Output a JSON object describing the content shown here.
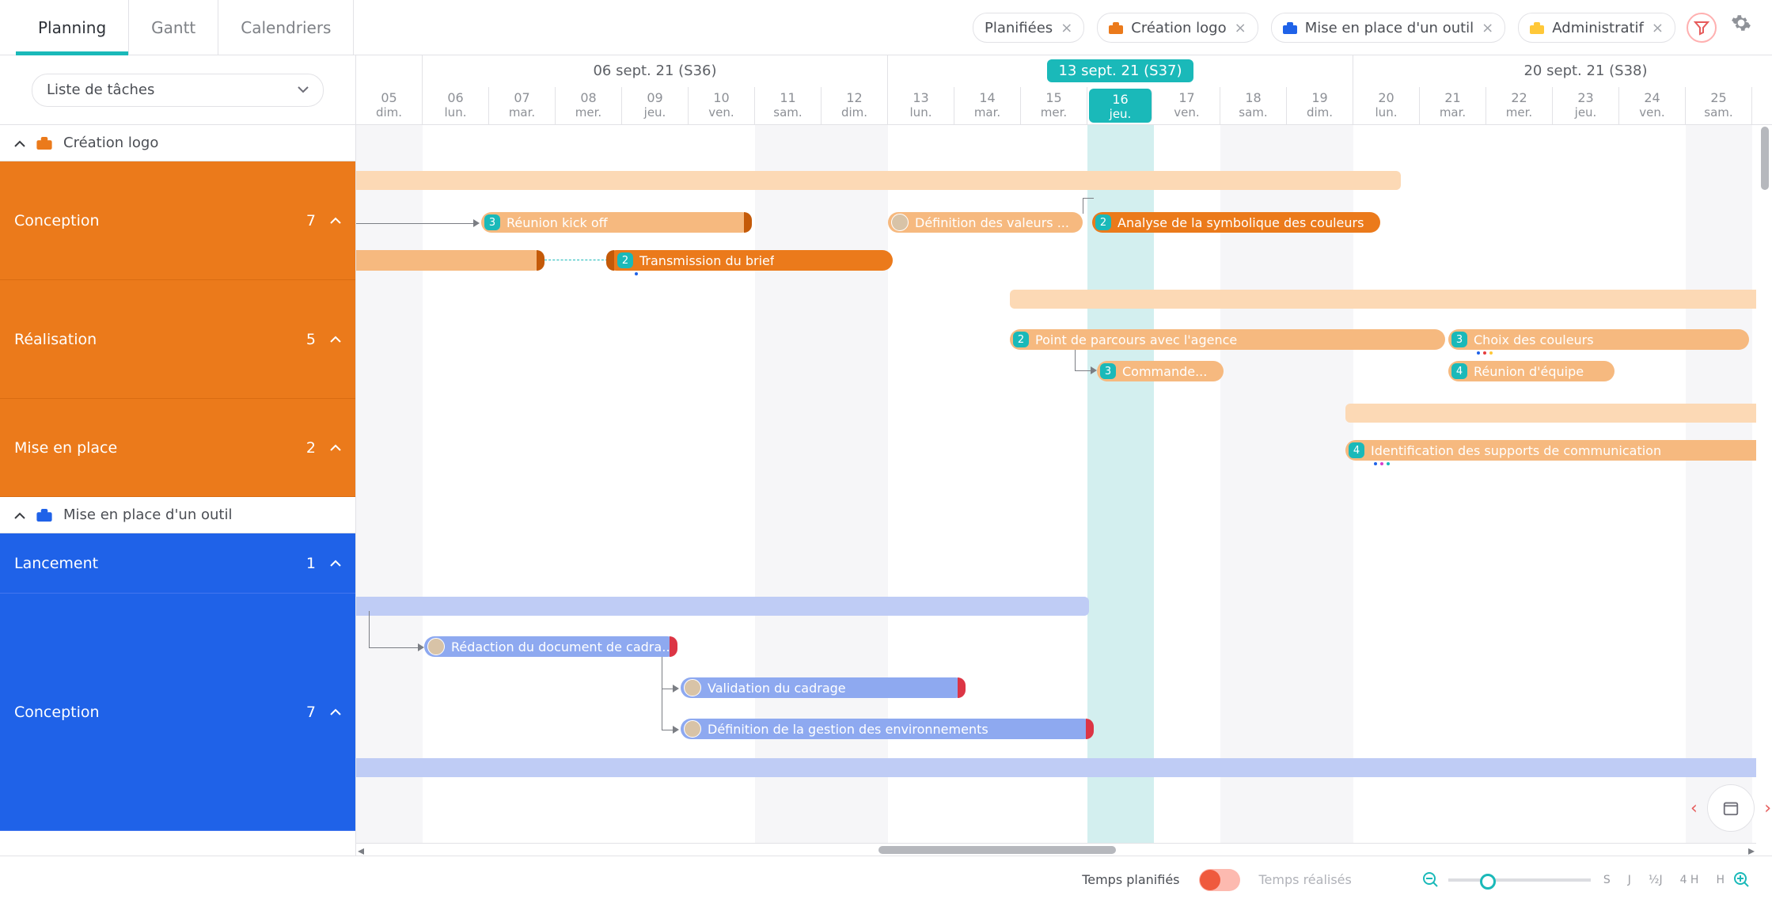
{
  "tabs": {
    "planning": "Planning",
    "gantt": "Gantt",
    "calendriers": "Calendriers"
  },
  "filters": {
    "planifiees": "Planifiées",
    "creation_logo": "Création logo",
    "mise_outil": "Mise en place d'un outil",
    "administratif": "Administratif"
  },
  "sidebar": {
    "select_label": "Liste de tâches",
    "projects": [
      {
        "name": "Création logo",
        "color": "orange",
        "sections": [
          {
            "label": "Conception",
            "count": 7
          },
          {
            "label": "Réalisation",
            "count": 5
          },
          {
            "label": "Mise en place",
            "count": 2
          }
        ]
      },
      {
        "name": "Mise en place d'un outil",
        "color": "blue",
        "sections": [
          {
            "label": "Lancement",
            "count": 1
          },
          {
            "label": "Conception",
            "count": 7
          }
        ]
      }
    ]
  },
  "timeline": {
    "weeks": [
      {
        "label": "06 sept. 21 (S36)",
        "days": 7,
        "current": false
      },
      {
        "label": "13 sept. 21 (S37)",
        "days": 7,
        "current": true
      },
      {
        "label": "20 sept. 21 (S38)",
        "days": 7,
        "current": false
      }
    ],
    "days": [
      {
        "n": "05",
        "d": "dim.",
        "we": true
      },
      {
        "n": "06",
        "d": "lun."
      },
      {
        "n": "07",
        "d": "mar."
      },
      {
        "n": "08",
        "d": "mer."
      },
      {
        "n": "09",
        "d": "jeu."
      },
      {
        "n": "10",
        "d": "ven."
      },
      {
        "n": "11",
        "d": "sam.",
        "we": true
      },
      {
        "n": "12",
        "d": "dim.",
        "we": true
      },
      {
        "n": "13",
        "d": "lun."
      },
      {
        "n": "14",
        "d": "mar."
      },
      {
        "n": "15",
        "d": "mer."
      },
      {
        "n": "16",
        "d": "jeu.",
        "today": true
      },
      {
        "n": "17",
        "d": "ven."
      },
      {
        "n": "18",
        "d": "sam.",
        "we": true
      },
      {
        "n": "19",
        "d": "dim.",
        "we": true
      },
      {
        "n": "20",
        "d": "lun."
      },
      {
        "n": "21",
        "d": "mar."
      },
      {
        "n": "22",
        "d": "mer."
      },
      {
        "n": "23",
        "d": "jeu."
      },
      {
        "n": "24",
        "d": "ven."
      },
      {
        "n": "25",
        "d": "sam.",
        "we": true
      }
    ],
    "tasks": {
      "reunion_kickoff": {
        "label": "Réunion kick off",
        "badge": 3
      },
      "definition_valeurs": {
        "label": "Définition des valeurs ..."
      },
      "analyse_couleurs": {
        "label": "Analyse de la symbolique des couleurs",
        "badge": 2
      },
      "transmission_brief": {
        "label": "Transmission du brief",
        "badge": 2
      },
      "point_parcours": {
        "label": "Point de parcours avec l'agence",
        "badge": 2
      },
      "choix_couleurs": {
        "label": "Choix des couleurs",
        "badge": 3
      },
      "commande": {
        "label": "Commande...",
        "badge": 3
      },
      "reunion_equipe": {
        "label": "Réunion d'équipe",
        "badge": 4
      },
      "identification_supports": {
        "label": "Identification des supports de communication",
        "badge": 4
      },
      "redaction_cadrage": {
        "label": "Rédaction du document de cadrage"
      },
      "validation_cadrage": {
        "label": "Validation du cadrage"
      },
      "definition_gestion": {
        "label": "Définition de la gestion des environnements"
      }
    }
  },
  "footer": {
    "temps_planifies": "Temps planifiés",
    "temps_realises": "Temps réalisés",
    "zoom_labels": [
      "S",
      "J",
      "½J",
      "4 H",
      "H"
    ]
  },
  "chart_data": {
    "type": "gantt",
    "date_range": {
      "start": "2021-09-05",
      "end": "2021-09-25"
    },
    "today": "2021-09-16",
    "projects": [
      {
        "name": "Création logo",
        "color": "#eb7a1b",
        "sections": [
          {
            "name": "Conception",
            "summary_start": "2021-09-03",
            "summary_end": "2021-09-19",
            "tasks": [
              {
                "name": "Réunion kick off",
                "start": "2021-09-07",
                "end": "2021-09-10",
                "assignees": 3,
                "depends_on": "(prior task)"
              },
              {
                "name": "Définition des valeurs ...",
                "start": "2021-09-13",
                "end": "2021-09-15",
                "assignees": 1
              },
              {
                "name": "Analyse de la symbolique des couleurs",
                "start": "2021-09-16",
                "end": "2021-09-19",
                "assignees": 2
              },
              {
                "name": "Transmission du brief",
                "start": "2021-09-09",
                "end": "2021-09-14",
                "assignees": 2
              }
            ]
          },
          {
            "name": "Réalisation",
            "summary_start": "2021-09-15",
            "summary_end": "2021-09-30",
            "tasks": [
              {
                "name": "Point de parcours avec l'agence",
                "start": "2021-09-15",
                "end": "2021-09-21",
                "assignees": 2
              },
              {
                "name": "Choix des couleurs",
                "start": "2021-09-22",
                "end": "2021-09-26",
                "assignees": 3
              },
              {
                "name": "Commande...",
                "start": "2021-09-16",
                "end": "2021-09-17",
                "assignees": 3
              },
              {
                "name": "Réunion d'équipe",
                "start": "2021-09-22",
                "end": "2021-09-24",
                "assignees": 4
              }
            ]
          },
          {
            "name": "Mise en place",
            "summary_start": "2021-09-19",
            "summary_end": "2021-09-30",
            "tasks": [
              {
                "name": "Identification des supports de communication",
                "start": "2021-09-19",
                "end": "2021-09-26",
                "assignees": 4
              }
            ]
          }
        ]
      },
      {
        "name": "Mise en place d'un outil",
        "color": "#1f62e8",
        "sections": [
          {
            "name": "Lancement",
            "tasks": []
          },
          {
            "name": "Conception",
            "summary_start": "2021-09-03",
            "summary_end": "2021-09-15",
            "tasks": [
              {
                "name": "Rédaction du document de cadrage",
                "start": "2021-09-06",
                "end": "2021-09-09",
                "assignees": 1
              },
              {
                "name": "Validation du cadrage",
                "start": "2021-09-10",
                "end": "2021-09-14",
                "assignees": 1,
                "depends_on": "Rédaction du document de cadrage"
              },
              {
                "name": "Définition de la gestion des environnements",
                "start": "2021-09-10",
                "end": "2021-09-16",
                "assignees": 1,
                "depends_on": "Rédaction du document de cadrage"
              }
            ]
          }
        ]
      }
    ]
  }
}
